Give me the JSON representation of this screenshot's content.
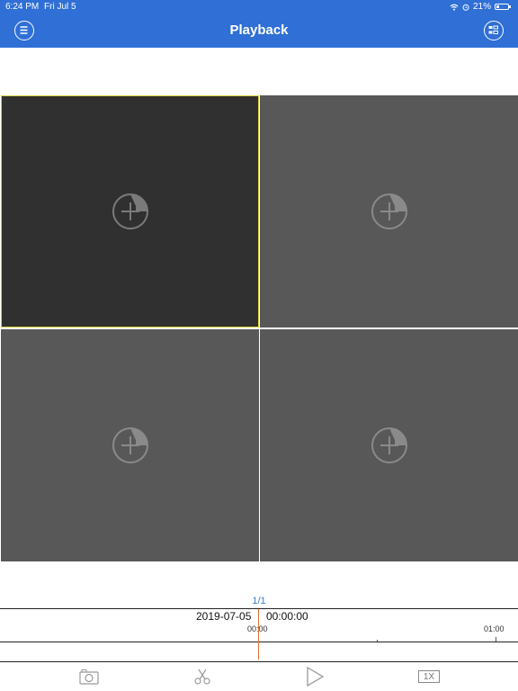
{
  "status_bar": {
    "time": "6:24 PM",
    "date": "Fri Jul 5",
    "battery": "21%",
    "battery_level": 0.21
  },
  "header": {
    "title": "Playback",
    "menu_icon": "menu-icon",
    "devices_icon": "device-list-icon",
    "background_color": "#2f6fd6"
  },
  "grid": {
    "selected_cell": 1,
    "selected_border_color": "#d7d23c",
    "add_icon": "add-channel-icon"
  },
  "page_indicator": "1/1",
  "timeline": {
    "date": "2019-07-05",
    "time": "00:00:00",
    "labels": [
      "00:00",
      "01:00"
    ],
    "cursor_color": "#e07030"
  },
  "toolbar": {
    "snapshot_icon": "camera-icon",
    "clip_icon": "scissors-icon",
    "play_icon": "play-icon",
    "speed_label": "1X"
  }
}
